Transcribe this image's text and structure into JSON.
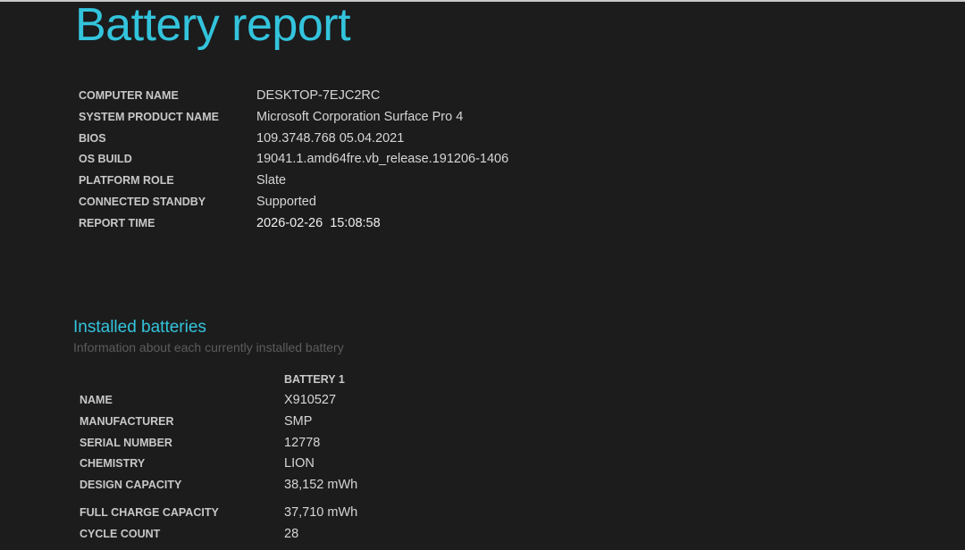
{
  "title": "Battery report",
  "system_info": [
    {
      "label": "COMPUTER NAME",
      "value": "DESKTOP-7EJC2RC"
    },
    {
      "label": "SYSTEM PRODUCT NAME",
      "value": "Microsoft Corporation Surface Pro 4"
    },
    {
      "label": "BIOS",
      "value": "109.3748.768 05.04.2021"
    },
    {
      "label": "OS BUILD",
      "value": "19041.1.amd64fre.vb_release.191206-1406"
    },
    {
      "label": "PLATFORM ROLE",
      "value": "Slate"
    },
    {
      "label": "CONNECTED STANDBY",
      "value": "Supported"
    },
    {
      "label": "REPORT TIME",
      "value": "2026-02-26  15:08:58"
    }
  ],
  "installed_batteries": {
    "heading": "Installed batteries",
    "subtitle": "Information about each currently installed battery",
    "column_header": "BATTERY 1",
    "rows": [
      {
        "label": "NAME",
        "value": "X910527"
      },
      {
        "label": "MANUFACTURER",
        "value": "SMP"
      },
      {
        "label": "SERIAL NUMBER",
        "value": "12778"
      },
      {
        "label": "CHEMISTRY",
        "value": "LION"
      },
      {
        "label": "DESIGN CAPACITY",
        "value": "38,152 mWh"
      },
      {
        "label": "FULL CHARGE CAPACITY",
        "value": "37,710 mWh"
      },
      {
        "label": "CYCLE COUNT",
        "value": "28"
      }
    ]
  },
  "colors": {
    "accent": "#33c4dc",
    "background": "#1c1c1d",
    "label": "#c8c8c8",
    "value": "#d6d6d6",
    "subtitle": "#5c5c5c"
  }
}
